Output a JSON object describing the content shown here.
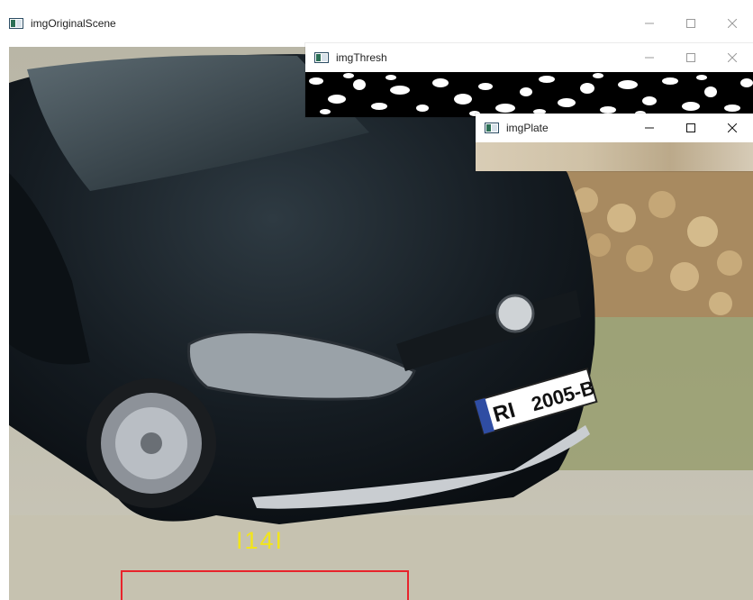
{
  "windows": {
    "scene": {
      "title": "imgOriginalScene"
    },
    "thresh": {
      "title": "imgThresh"
    },
    "plate": {
      "title": "imgPlate"
    }
  },
  "overlay": {
    "detected_text": "I14I",
    "text_color": "#f2e51b",
    "box_color": "#e8232b"
  },
  "plate": {
    "left": "RI",
    "right": "2005-B"
  },
  "controls": {
    "minimize": "minimize-icon",
    "maximize": "maximize-icon",
    "close": "close-icon"
  }
}
